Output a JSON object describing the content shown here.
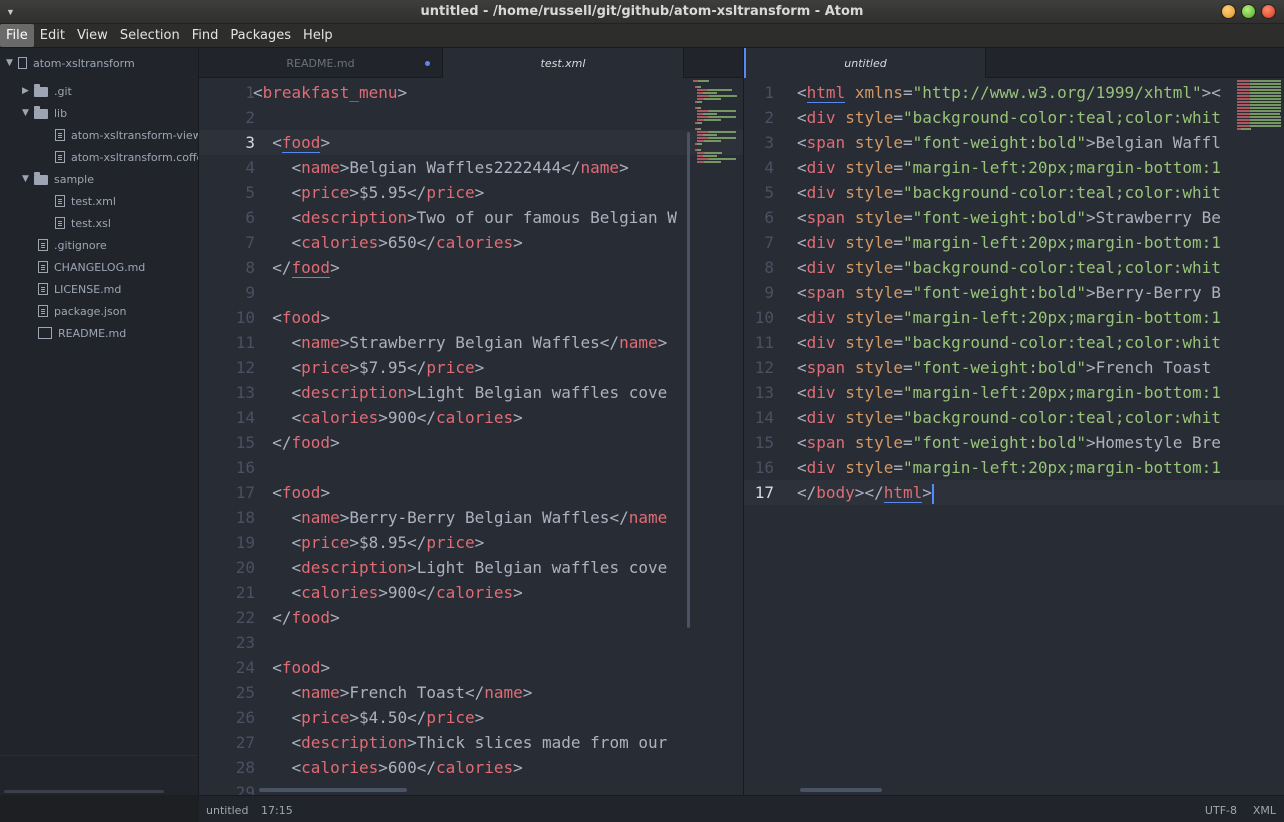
{
  "window": {
    "title": "untitled - /home/russell/git/github/atom-xsltransform - Atom"
  },
  "menu": [
    "File",
    "Edit",
    "View",
    "Selection",
    "Find",
    "Packages",
    "Help"
  ],
  "tree": {
    "project": "atom-xsltransform",
    "items": [
      {
        "label": ".git",
        "type": "folder",
        "expanded": false
      },
      {
        "label": "lib",
        "type": "folder",
        "expanded": true
      },
      {
        "label": "atom-xsltransform-view.coffee",
        "type": "file"
      },
      {
        "label": "atom-xsltransform.coffee",
        "type": "file"
      },
      {
        "label": "sample",
        "type": "folder",
        "expanded": true
      },
      {
        "label": "test.xml",
        "type": "file"
      },
      {
        "label": "test.xsl",
        "type": "file"
      },
      {
        "label": ".gitignore",
        "type": "file"
      },
      {
        "label": "CHANGELOG.md",
        "type": "file"
      },
      {
        "label": "LICENSE.md",
        "type": "file"
      },
      {
        "label": "package.json",
        "type": "file"
      },
      {
        "label": "README.md",
        "type": "book"
      }
    ]
  },
  "left_pane": {
    "tabs": [
      {
        "label": "README.md",
        "modified": true
      },
      {
        "label": "test.xml",
        "active": true
      }
    ],
    "lines": [
      {
        "n": "1",
        "text": "<breakfast_menu>"
      },
      {
        "n": "2",
        "text": ""
      },
      {
        "n": "3",
        "text": "  <food>"
      },
      {
        "n": "4",
        "text": "    <name>Belgian Waffles2222444</name>"
      },
      {
        "n": "5",
        "text": "    <price>$5.95</price>"
      },
      {
        "n": "6",
        "text": "    <description>Two of our famous Belgian W"
      },
      {
        "n": "7",
        "text": "    <calories>650</calories>"
      },
      {
        "n": "8",
        "text": "  </food>"
      },
      {
        "n": "9",
        "text": ""
      },
      {
        "n": "10",
        "text": "  <food>"
      },
      {
        "n": "11",
        "text": "    <name>Strawberry Belgian Waffles</name>"
      },
      {
        "n": "12",
        "text": "    <price>$7.95</price>"
      },
      {
        "n": "13",
        "text": "    <description>Light Belgian waffles cove"
      },
      {
        "n": "14",
        "text": "    <calories>900</calories>"
      },
      {
        "n": "15",
        "text": "  </food>"
      },
      {
        "n": "16",
        "text": ""
      },
      {
        "n": "17",
        "text": "  <food>"
      },
      {
        "n": "18",
        "text": "    <name>Berry-Berry Belgian Waffles</name"
      },
      {
        "n": "19",
        "text": "    <price>$8.95</price>"
      },
      {
        "n": "20",
        "text": "    <description>Light Belgian waffles cove"
      },
      {
        "n": "21",
        "text": "    <calories>900</calories>"
      },
      {
        "n": "22",
        "text": "  </food>"
      },
      {
        "n": "23",
        "text": ""
      },
      {
        "n": "24",
        "text": "  <food>"
      },
      {
        "n": "25",
        "text": "    <name>French Toast</name>"
      },
      {
        "n": "26",
        "text": "    <price>$4.50</price>"
      },
      {
        "n": "27",
        "text": "    <description>Thick slices made from our"
      },
      {
        "n": "28",
        "text": "    <calories>600</calories>"
      },
      {
        "n": "29",
        "text": ""
      }
    ]
  },
  "right_pane": {
    "tabs": [
      {
        "label": "untitled",
        "active": true
      }
    ],
    "lines": [
      {
        "n": "1",
        "text": "<html xmlns=\"http://www.w3.org/1999/xhtml\"><"
      },
      {
        "n": "2",
        "text": "<div style=\"background-color:teal;color:whit"
      },
      {
        "n": "3",
        "text": "<span style=\"font-weight:bold\">Belgian Waffl"
      },
      {
        "n": "4",
        "text": "<div style=\"margin-left:20px;margin-bottom:1"
      },
      {
        "n": "5",
        "text": "<div style=\"background-color:teal;color:whit"
      },
      {
        "n": "6",
        "text": "<span style=\"font-weight:bold\">Strawberry Be"
      },
      {
        "n": "7",
        "text": "<div style=\"margin-left:20px;margin-bottom:1"
      },
      {
        "n": "8",
        "text": "<div style=\"background-color:teal;color:whit"
      },
      {
        "n": "9",
        "text": "<span style=\"font-weight:bold\">Berry-Berry B"
      },
      {
        "n": "10",
        "text": "<div style=\"margin-left:20px;margin-bottom:1"
      },
      {
        "n": "11",
        "text": "<div style=\"background-color:teal;color:whit"
      },
      {
        "n": "12",
        "text": "<span style=\"font-weight:bold\">French Toast"
      },
      {
        "n": "13",
        "text": "<div style=\"margin-left:20px;margin-bottom:1"
      },
      {
        "n": "14",
        "text": "<div style=\"background-color:teal;color:whit"
      },
      {
        "n": "15",
        "text": "<span style=\"font-weight:bold\">Homestyle Bre"
      },
      {
        "n": "16",
        "text": "<div style=\"margin-left:20px;margin-bottom:1"
      },
      {
        "n": "17",
        "text": "</body></html>"
      }
    ]
  },
  "status": {
    "file": "untitled",
    "cursor": "17:15",
    "encoding": "UTF-8",
    "grammar": "XML"
  },
  "colors": {
    "tag": "#e06c75",
    "attr": "#d19a66",
    "string": "#98c379",
    "accent": "#568af2"
  }
}
